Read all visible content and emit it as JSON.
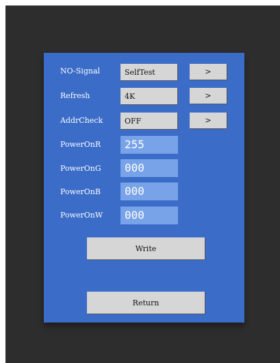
{
  "rows": [
    {
      "label": "NO-Signal",
      "value": "SelfTest",
      "action": ">"
    },
    {
      "label": "Refresh",
      "value": "4K",
      "action": ">"
    },
    {
      "label": "AddrCheck",
      "value": "OFF",
      "action": ">"
    }
  ],
  "power": [
    {
      "label": "PowerOnR",
      "value": "255"
    },
    {
      "label": "PowerOnG",
      "value": "000"
    },
    {
      "label": "PowerOnB",
      "value": "000"
    },
    {
      "label": "PowerOnW",
      "value": "000"
    }
  ],
  "buttons": {
    "write": "Write",
    "return": "Return"
  }
}
